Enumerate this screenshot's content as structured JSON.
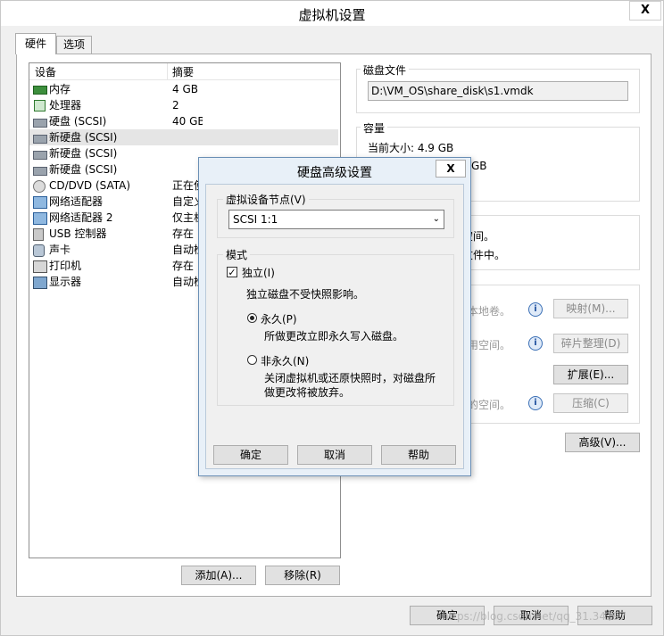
{
  "window": {
    "title": "虚拟机设置",
    "close_glyph": "X"
  },
  "tabs": [
    {
      "label": "硬件"
    },
    {
      "label": "选项"
    }
  ],
  "device_list": {
    "col_device": "设备",
    "col_summary": "摘要",
    "rows": [
      {
        "name": "内存",
        "summary": "4 GB",
        "icon": "memory-icon"
      },
      {
        "name": "处理器",
        "summary": "2",
        "icon": "processor-icon"
      },
      {
        "name": "硬盘 (SCSI)",
        "summary": "40 GB",
        "icon": "harddisk-icon"
      },
      {
        "name": "新硬盘 (SCSI)",
        "summary": "",
        "icon": "harddisk-icon"
      },
      {
        "name": "新硬盘 (SCSI)",
        "summary": "",
        "icon": "harddisk-icon"
      },
      {
        "name": "新硬盘 (SCSI)",
        "summary": "",
        "icon": "harddisk-icon"
      },
      {
        "name": "CD/DVD (SATA)",
        "summary": "正在使用",
        "icon": "cd-icon"
      },
      {
        "name": "网络适配器",
        "summary": "自定义",
        "icon": "network-icon"
      },
      {
        "name": "网络适配器 2",
        "summary": "仅主机",
        "icon": "network-icon"
      },
      {
        "name": "USB 控制器",
        "summary": "存在",
        "icon": "usb-icon"
      },
      {
        "name": "声卡",
        "summary": "自动检测",
        "icon": "sound-icon"
      },
      {
        "name": "打印机",
        "summary": "存在",
        "icon": "printer-icon"
      },
      {
        "name": "显示器",
        "summary": "自动检测",
        "icon": "display-icon"
      }
    ],
    "add_label": "添加(A)...",
    "remove_label": "移除(R)"
  },
  "disk_file": {
    "label": "磁盘文件",
    "path": "D:\\VM_OS\\share_disk\\s1.vmdk"
  },
  "capacity": {
    "label": "容量",
    "current_size": "当前大小: 4.9 GB",
    "gb_fragment": "GB"
  },
  "info_box": {
    "line1": "空间。",
    "line2": "文件中。"
  },
  "utilities": {
    "rows": [
      {
        "text": "本地卷。",
        "button": "映射(M)...",
        "enabled": false
      },
      {
        "text": "用空间。",
        "button": "碎片整理(D)",
        "enabled": false
      },
      {
        "text": "",
        "button": "扩展(E)...",
        "enabled": true
      },
      {
        "text": "的空间。",
        "button": "压缩(C)",
        "enabled": false
      }
    ],
    "advanced_label": "高级(V)..."
  },
  "footer": {
    "ok": "确定",
    "cancel": "取消",
    "help": "帮助",
    "watermark": "https://blog.csdn.net/qq_31.34297"
  },
  "dialog": {
    "title": "硬盘高级设置",
    "close_glyph": "X",
    "node_label": "虚拟设备节点(V)",
    "node_value": "SCSI 1:1",
    "mode_label": "模式",
    "independent_label": "独立(I)",
    "independent_checked": true,
    "independent_desc": "独立磁盘不受快照影响。",
    "persistent_label": "永久(P)",
    "persistent_desc": "所做更改立即永久写入磁盘。",
    "persistent_selected": true,
    "nonpersistent_label": "非永久(N)",
    "nonpersistent_desc1": "关闭虚拟机或还原快照时，对磁盘所",
    "nonpersistent_desc2": "做更改将被放弃。",
    "ok": "确定",
    "cancel": "取消",
    "help": "帮助"
  }
}
